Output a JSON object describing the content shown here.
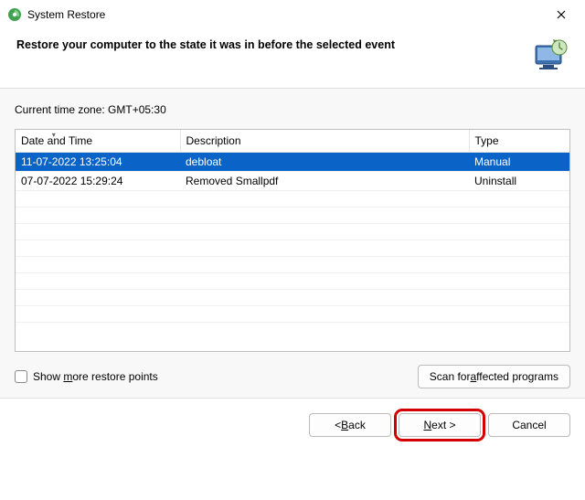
{
  "window": {
    "title": "System Restore"
  },
  "header": {
    "heading": "Restore your computer to the state it was in before the selected event"
  },
  "content": {
    "timezone_label": "Current time zone: GMT+05:30",
    "columns": {
      "datetime": "Date and Time",
      "description": "Description",
      "type": "Type"
    },
    "rows": [
      {
        "datetime": "11-07-2022 13:25:04",
        "description": "debloat",
        "type": "Manual",
        "selected": true
      },
      {
        "datetime": "07-07-2022 15:29:24",
        "description": "Removed Smallpdf",
        "type": "Uninstall",
        "selected": false
      }
    ],
    "show_more_text_pre": "Show ",
    "show_more_text_u": "m",
    "show_more_text_post": "ore restore points",
    "scan_pre": "Scan for ",
    "scan_u": "a",
    "scan_post": "ffected programs"
  },
  "footer": {
    "back_pre": "< ",
    "back_u": "B",
    "back_post": "ack",
    "next_u": "N",
    "next_post": "ext >",
    "cancel": "Cancel"
  }
}
